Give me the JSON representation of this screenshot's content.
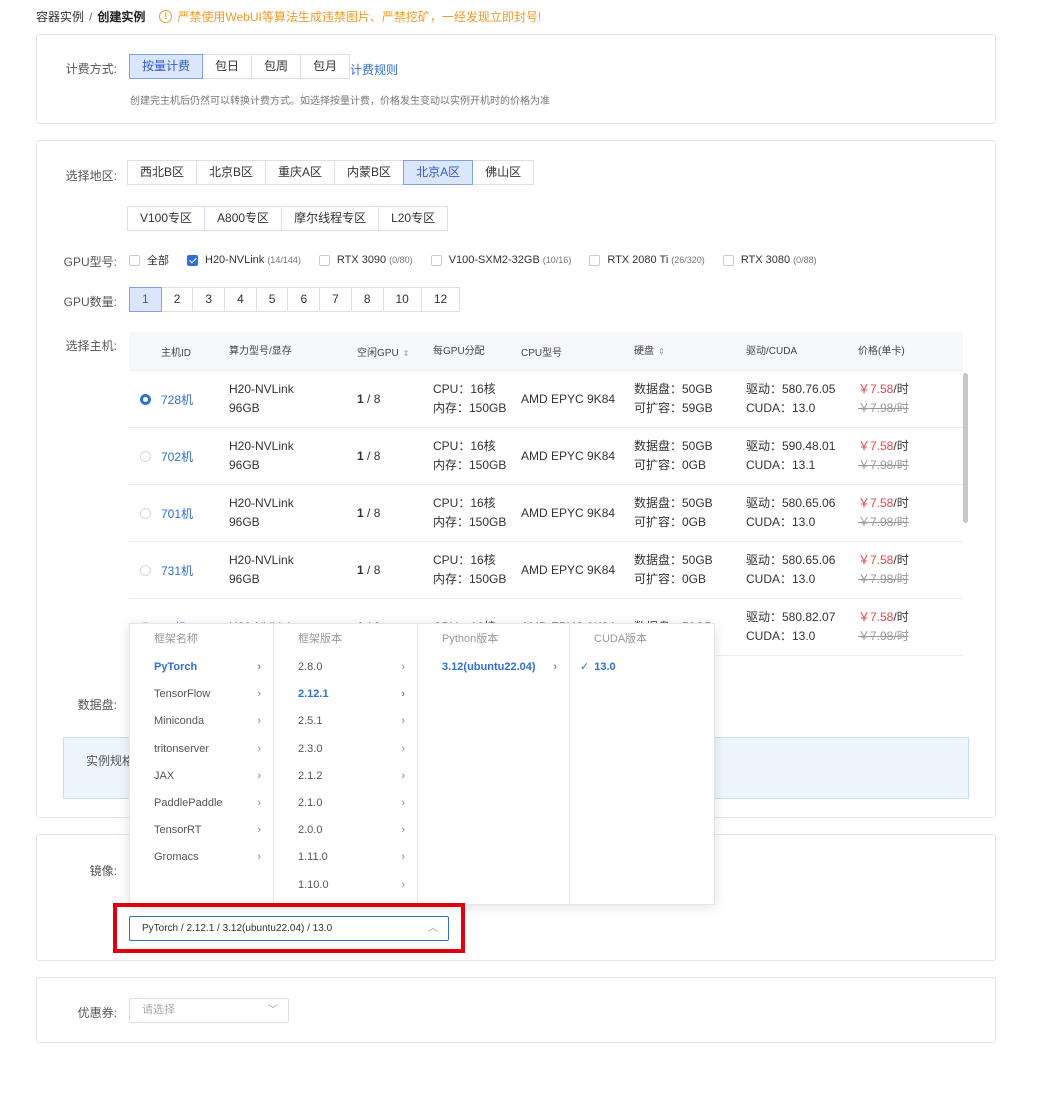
{
  "breadcrumb": {
    "parent": "容器实例",
    "sep": "/",
    "current": "创建实例",
    "warning_icon": "!",
    "warning": "严禁使用WebUI等算法生成违禁图片、严禁挖矿，一经发现立即封号!"
  },
  "billing": {
    "label": "计费方式:",
    "options": [
      "按量计费",
      "包日",
      "包周",
      "包月"
    ],
    "selected_index": 0,
    "rules_link": "计费规则",
    "hint": "创建完主机后仍然可以转换计费方式。如选择按量计费，价格发生变动以实例开机时的价格为准"
  },
  "region": {
    "label": "选择地区:",
    "row1": [
      "西北B区",
      "北京B区",
      "重庆A区",
      "内蒙B区",
      "北京A区",
      "佛山区"
    ],
    "row2": [
      "V100专区",
      "A800专区",
      "摩尔线程专区",
      "L20专区"
    ],
    "selected": "北京A区"
  },
  "gpu_type": {
    "label": "GPU型号:",
    "items": [
      {
        "name": "全部",
        "count": "",
        "checked": false
      },
      {
        "name": "H20-NVLink",
        "count": "(14/144)",
        "checked": true
      },
      {
        "name": "RTX 3090",
        "count": "(0/80)",
        "checked": false
      },
      {
        "name": "V100-SXM2-32GB",
        "count": "(10/16)",
        "checked": false
      },
      {
        "name": "RTX 2080 Ti",
        "count": "(26/320)",
        "checked": false
      },
      {
        "name": "RTX 3080",
        "count": "(0/88)",
        "checked": false
      }
    ]
  },
  "gpu_count": {
    "label": "GPU数量:",
    "options": [
      "1",
      "2",
      "3",
      "4",
      "5",
      "6",
      "7",
      "8",
      "10",
      "12"
    ],
    "selected": "1"
  },
  "hosts": {
    "label": "选择主机:",
    "headers": [
      "主机ID",
      "算力型号/显存",
      "空闲GPU",
      "每GPU分配",
      "CPU型号",
      "硬盘",
      "驱动/CUDA",
      "价格(单卡)"
    ],
    "sort_icon": "⇕",
    "rows": [
      {
        "id": "728机",
        "model": "H20-NVLink",
        "mem": "96GB",
        "free": "1",
        "total": " / 8",
        "cpu_alloc": "CPU：16核",
        "ram_alloc": "内存：150GB",
        "cpu": "AMD EPYC 9K84",
        "disk": "数据盘：50GB",
        "disk_ext": "可扩容：59GB",
        "driver": "驱动：580.76.05",
        "cuda": "CUDA：13.0",
        "price": "￥7.58",
        "unit": "/时",
        "old_price": "￥7.98/时",
        "selected": true
      },
      {
        "id": "702机",
        "model": "H20-NVLink",
        "mem": "96GB",
        "free": "1",
        "total": " / 8",
        "cpu_alloc": "CPU：16核",
        "ram_alloc": "内存：150GB",
        "cpu": "AMD EPYC 9K84",
        "disk": "数据盘：50GB",
        "disk_ext": "可扩容：0GB",
        "driver": "驱动：590.48.01",
        "cuda": "CUDA：13.1",
        "price": "￥7.58",
        "unit": "/时",
        "old_price": "￥7.98/时",
        "selected": false
      },
      {
        "id": "701机",
        "model": "H20-NVLink",
        "mem": "96GB",
        "free": "1",
        "total": " / 8",
        "cpu_alloc": "CPU：16核",
        "ram_alloc": "内存：150GB",
        "cpu": "AMD EPYC 9K84",
        "disk": "数据盘：50GB",
        "disk_ext": "可扩容：0GB",
        "driver": "驱动：580.65.06",
        "cuda": "CUDA：13.0",
        "price": "￥7.58",
        "unit": "/时",
        "old_price": "￥7.98/时",
        "selected": false
      },
      {
        "id": "731机",
        "model": "H20-NVLink",
        "mem": "96GB",
        "free": "1",
        "total": " / 8",
        "cpu_alloc": "CPU：16核",
        "ram_alloc": "内存：150GB",
        "cpu": "AMD EPYC 9K84",
        "disk": "数据盘：50GB",
        "disk_ext": "可扩容：0GB",
        "driver": "驱动：580.65.06",
        "cuda": "CUDA：13.0",
        "price": "￥7.58",
        "unit": "/时",
        "old_price": "￥7.98/时",
        "selected": false
      },
      {
        "id": "7..机",
        "model": "H20-NVLink",
        "mem": "",
        "free": "1",
        "total": " / 8",
        "cpu_alloc": "CPU：16核",
        "ram_alloc": "",
        "cpu": "AMD EPYC 9K84",
        "disk": "数据盘：50GB",
        "disk_ext": "",
        "driver": "驱动：580.82.07",
        "cuda": "CUDA：13.0",
        "price": "￥7.58",
        "unit": "/时",
        "old_price": "￥7.98/时",
        "selected": false
      }
    ]
  },
  "data_disk": {
    "label": "数据盘:"
  },
  "spec": {
    "label": "实例规格"
  },
  "image": {
    "label": "镜像:",
    "value": "PyTorch / 2.12.1 / 3.12(ubuntu22.04) / 13.0",
    "caret": "︿",
    "chevron": "›",
    "check_mark": "✓",
    "columns": {
      "framework": {
        "title": "框架名称",
        "items": [
          "PyTorch",
          "TensorFlow",
          "Miniconda",
          "tritonserver",
          "JAX",
          "PaddlePaddle",
          "TensorRT",
          "Gromacs"
        ],
        "selected": "PyTorch"
      },
      "version": {
        "title": "框架版本",
        "items": [
          "2.8.0",
          "2.12.1",
          "2.5.1",
          "2.3.0",
          "2.1.2",
          "2.1.0",
          "2.0.0",
          "1.11.0",
          "1.10.0"
        ],
        "selected": "2.12.1"
      },
      "python": {
        "title": "Python版本",
        "items": [
          "3.12(ubuntu22.04)"
        ],
        "selected": "3.12(ubuntu22.04)"
      },
      "cuda": {
        "title": "CUDA版本",
        "items": [
          "13.0"
        ],
        "selected": "13.0"
      }
    }
  },
  "coupon": {
    "label": "优惠券:",
    "placeholder": "请选择",
    "caret": "﹀"
  },
  "colors": {
    "accent": "#2f6fd8",
    "price": "#e54545",
    "warning": "#f19b28",
    "highlight": "#e0000f"
  }
}
